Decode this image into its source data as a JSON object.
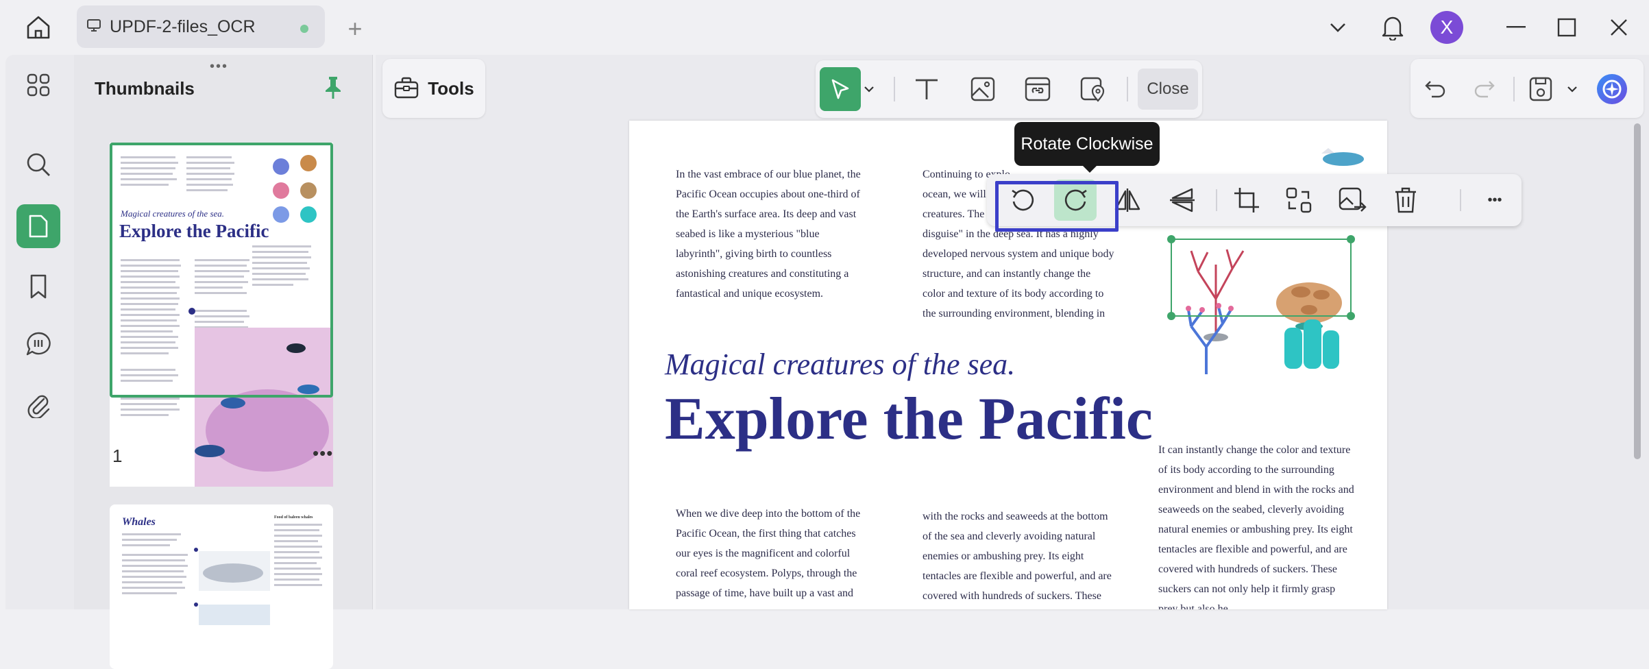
{
  "titlebar": {
    "tab_title": "UPDF-2-files_OCR",
    "new_tab": "+",
    "avatar_letter": "X"
  },
  "left_rail": {
    "items": [
      "thumbnails",
      "search",
      "pages",
      "bookmarks",
      "comments",
      "attachments"
    ]
  },
  "thumbnails_panel": {
    "title": "Thumbnails",
    "grip": "•••",
    "page1_number": "1",
    "page1_more": "•••",
    "page1": {
      "subtitle": "Magical creatures of the sea.",
      "title": "Explore the Pacific"
    },
    "page2": {
      "title": "Whales",
      "section": "Food of baleen whales"
    }
  },
  "tools_button": {
    "label": "Tools"
  },
  "edit_toolbar": {
    "close_label": "Close",
    "icons": [
      "pointer-icon",
      "text-icon",
      "image-icon",
      "link-icon",
      "map-pin-icon"
    ]
  },
  "image_toolbar": {
    "tooltip": "Rotate Clockwise",
    "more": "•••"
  },
  "document": {
    "col1": "In the vast embrace of our blue planet, the Pacific Ocean occupies about one-third of the Earth's surface area. Its deep and vast seabed is like a mysterious \"blue labyrinth\", giving birth to countless astonishing creatures and constituting a fantastical and unique ecosystem.",
    "col2_lines": [
      "Continuing to explo",
      "ocean, we will en",
      "creatures. The gr",
      "disguise\" in the deep sea. It has a highly",
      "developed nervous system and unique body",
      "structure, and can instantly change the",
      "color and texture of its body according to",
      "the surrounding environment, blending in"
    ],
    "subtitle": "Magical creatures of the sea.",
    "title": "Explore the Pacific",
    "col1_bottom": "When we dive deep into the bottom of the Pacific Ocean, the first thing that catches our eyes is the magnificent and colorful coral reef ecosystem. Polyps, through the passage of time, have built up a vast and",
    "col2_bottom": "with the rocks and seaweeds at the bottom of the sea and cleverly avoiding natural enemies or ambushing prey. Its eight tentacles are flexible and powerful, and are covered with hundreds of suckers. These",
    "col3_bottom": "It can instantly change the color and texture of its body according to the surrounding environment and blend in with the rocks and seaweeds on the seabed, cleverly avoiding natural enemies or ambushing prey. Its eight tentacles are flexible and powerful, and are covered with hundreds of suckers. These suckers can not only help it firmly grasp prey but also he"
  },
  "colors": {
    "accent": "#3ea56a",
    "highlight": "#3b3fc9",
    "title_text": "#2c2f86"
  }
}
